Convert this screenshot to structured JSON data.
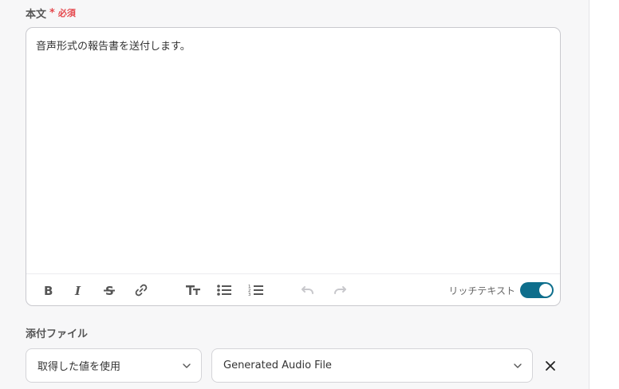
{
  "body_field": {
    "label": "本文",
    "required_mark": "*",
    "required_text": "必須",
    "content": "音声形式の報告書を送付します。"
  },
  "toolbar": {
    "icons": [
      "bold-icon",
      "italic-icon",
      "strikethrough-icon",
      "link-icon",
      "text-size-icon",
      "bulleted-list-icon",
      "numbered-list-icon",
      "undo-icon",
      "redo-icon"
    ],
    "rich_text_label": "リッチテキスト",
    "rich_text_enabled": true
  },
  "attachment_field": {
    "label": "添付ファイル",
    "source_select": {
      "value": "取得した値を使用"
    },
    "file_select": {
      "value": "Generated Audio File"
    }
  },
  "colors": {
    "accent": "#0e6e8c",
    "required": "#e5484d",
    "border": "#c9c9ce",
    "background": "#f7f7f8"
  }
}
